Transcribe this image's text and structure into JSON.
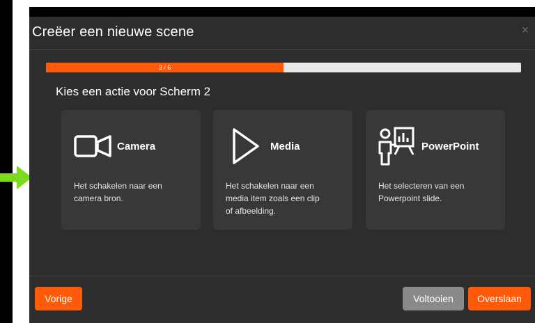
{
  "dialog": {
    "title": "Creëer een nieuwe scene",
    "close_icon": "close-icon"
  },
  "progress": {
    "label": "3 / 6",
    "fraction": 0.5,
    "fill_color": "#ff5a0a",
    "track_color": "#e8e8e8"
  },
  "prompt": "Kies een actie voor Scherm 2",
  "cards": [
    {
      "icon": "camera-icon",
      "title": "Camera",
      "desc_lines": [
        "Het schakelen naar een",
        "camera bron."
      ]
    },
    {
      "icon": "play-icon",
      "title": "Media",
      "desc_lines": [
        "Het schakelen naar een",
        "media item zoals een clip",
        "of afbeelding."
      ]
    },
    {
      "icon": "presentation-icon",
      "title": "PowerPoint",
      "desc_lines": [
        "Het selecteren van een",
        "Powerpoint slide."
      ]
    }
  ],
  "footer": {
    "prev_label": "Vorige",
    "finish_label": "Voltooien",
    "skip_label": "Overslaan"
  },
  "colors": {
    "accent": "#ff5a0a",
    "dialog_bg": "#2d2d2d",
    "card_bg": "#383838",
    "disabled_button": "#8a8a8a",
    "indicator_arrow": "#7ddb1e"
  }
}
